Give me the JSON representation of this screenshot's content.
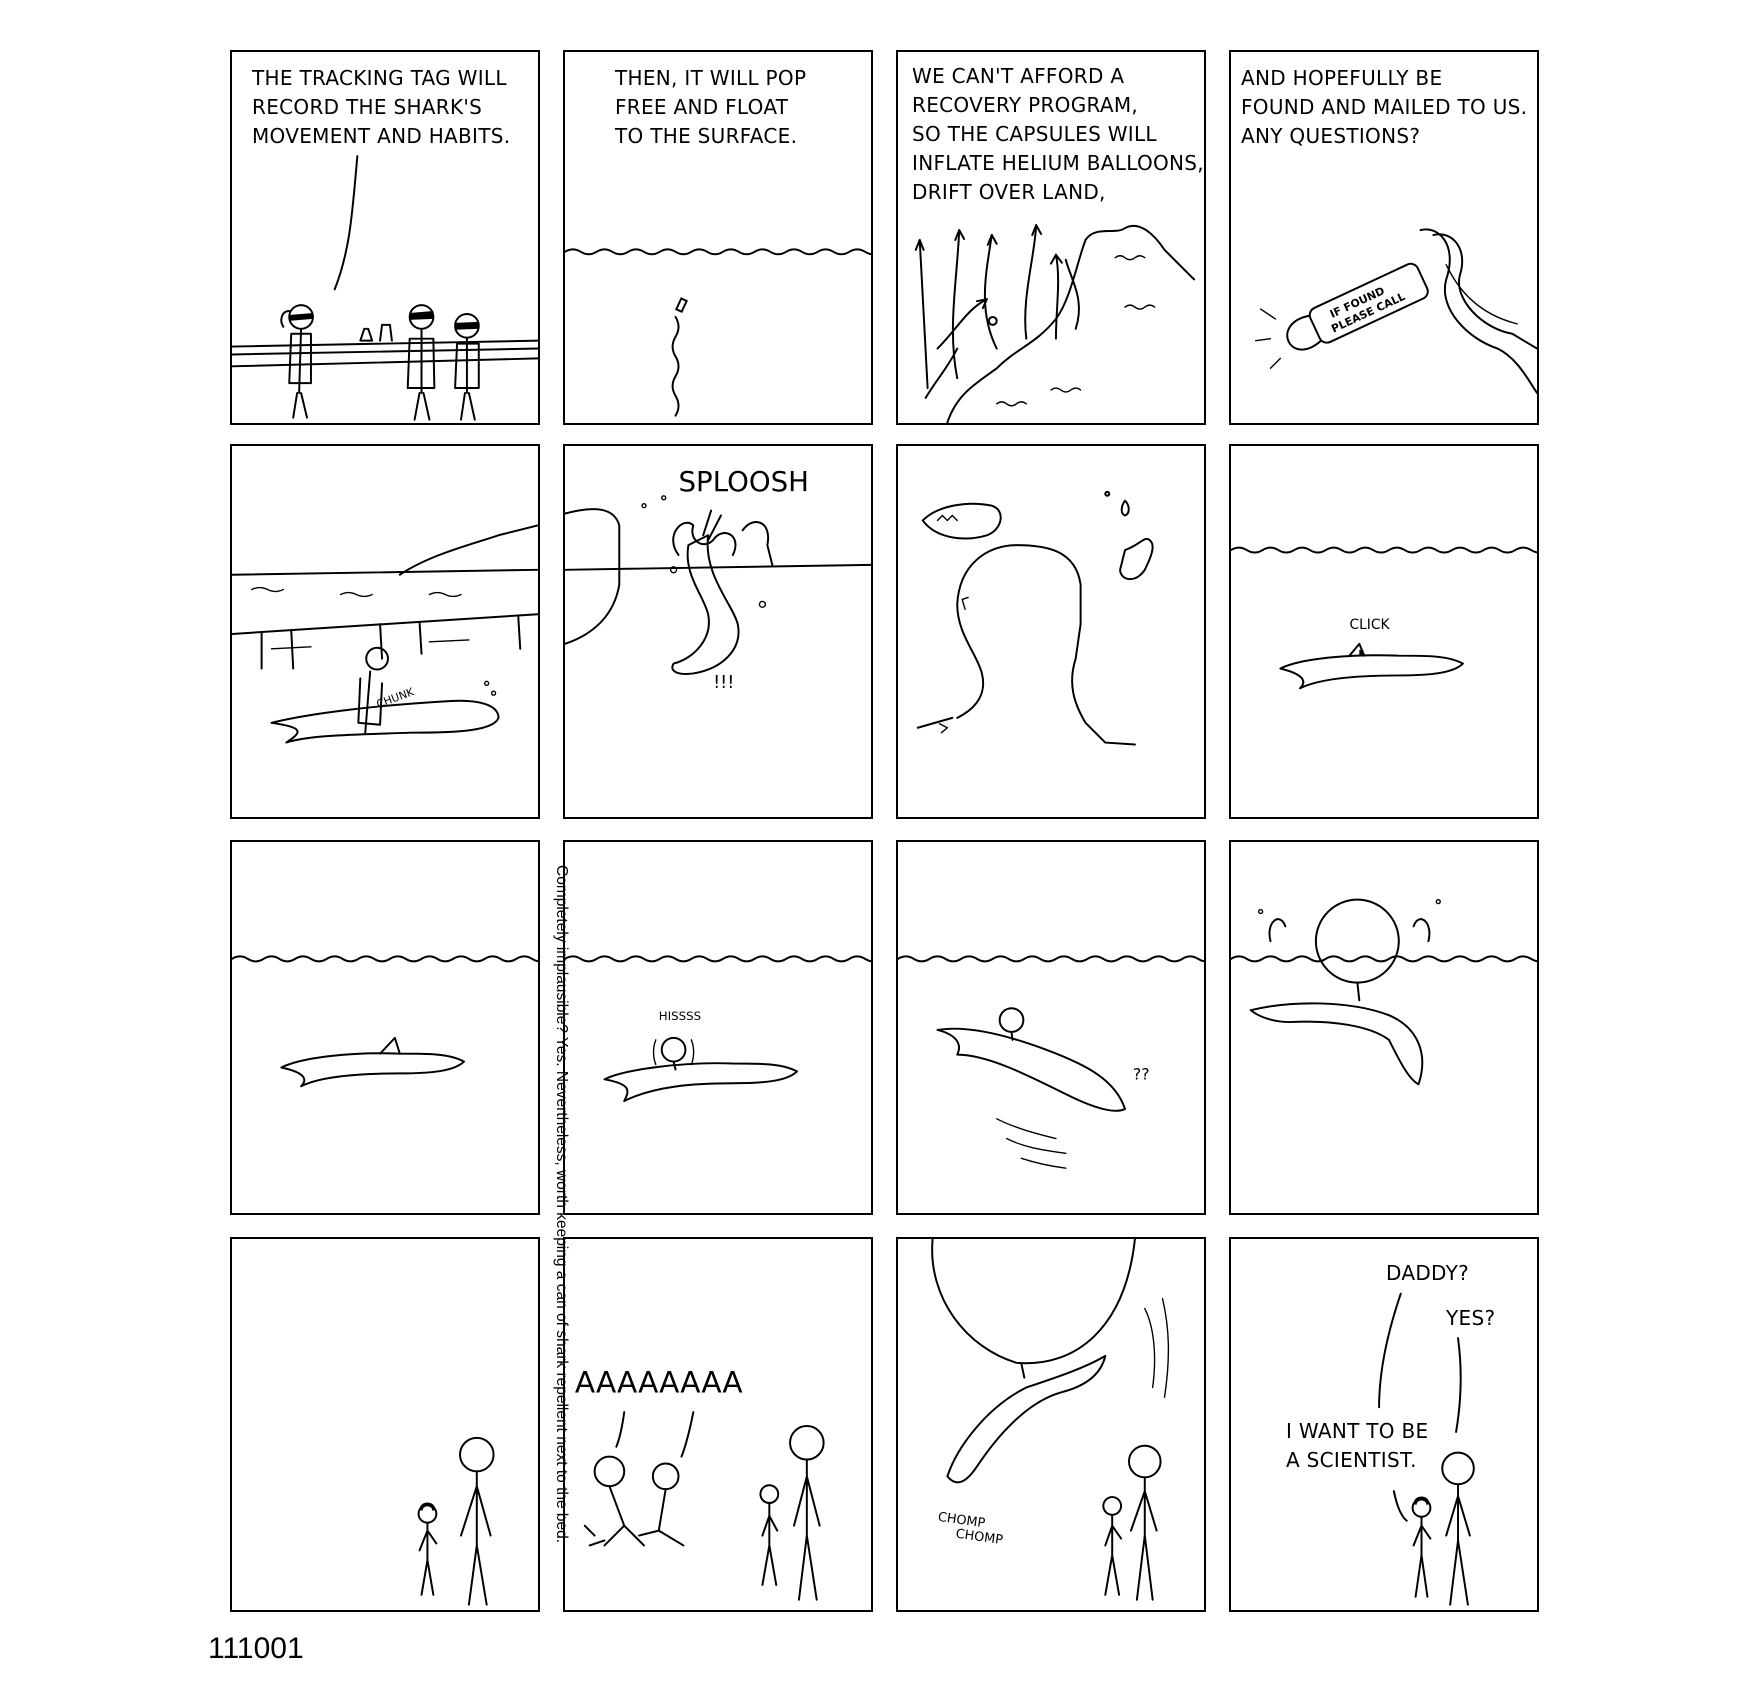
{
  "panels": {
    "p1": {
      "caption": "THE TRACKING TAG WILL\nRECORD THE SHARK'S\nMOVEMENT AND HABITS."
    },
    "p2": {
      "caption": "THEN, IT WILL POP\nFREE AND FLOAT\nTO THE SURFACE."
    },
    "p3": {
      "caption": "WE CAN'T AFFORD A\nRECOVERY PROGRAM,\nSO THE CAPSULES WILL\nINFLATE HELIUM BALLOONS,\nDRIFT OVER LAND,"
    },
    "p4": {
      "caption": "AND HOPEFULLY BE\nFOUND AND MAILED TO US.\nANY QUESTIONS?",
      "tag_text": "IF FOUND\nPLEASE CALL"
    },
    "p5": {
      "sfx": "CHUNK"
    },
    "p6": {
      "sfx": "SPLOOSH",
      "exclaim": "!!!"
    },
    "p8": {
      "sfx": "CLICK"
    },
    "p10": {
      "sfx": "HISSSS"
    },
    "p11": {
      "sfx": "??"
    },
    "p14": {
      "scream": "AAAAAAAA"
    },
    "p15": {
      "sfx_line1": "CHOMP",
      "sfx_line2": "CHOMP"
    },
    "p16": {
      "child_line": "DADDY?",
      "father_line": "YES?",
      "child_line2": "I WANT TO BE\nA SCIENTIST."
    }
  },
  "side_note": "Completely implausible? Yes. Nevertheless, worth keeping a can of shark repellent next to the bed.",
  "comic_id": "111001"
}
